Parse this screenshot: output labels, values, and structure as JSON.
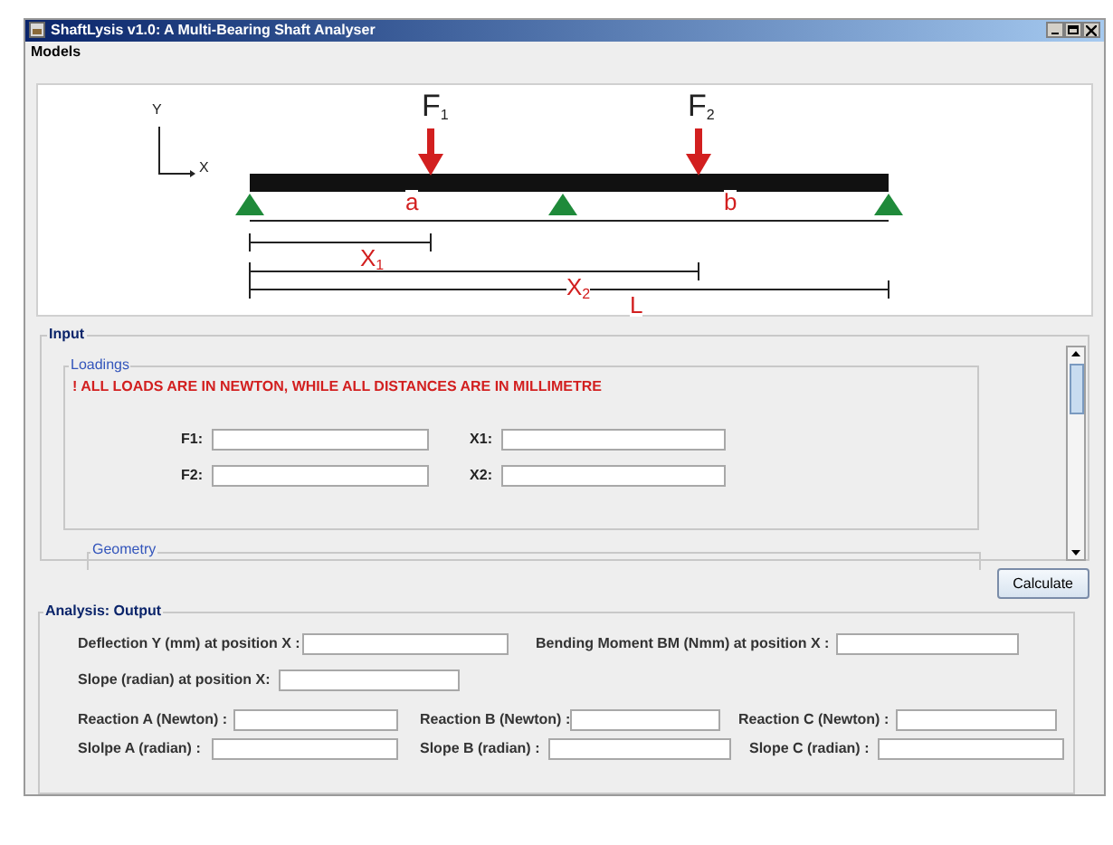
{
  "window": {
    "title": "ShaftLysis v1.0: A Multi-Bearing Shaft Analyser"
  },
  "menu": [
    "Models"
  ],
  "diagram": {
    "labels": [
      "Y",
      "X",
      "F$_{1}$",
      "F$_{2}$",
      "a",
      "b",
      "X$_{1}$",
      "X$_{2}$",
      "L"
    ]
  },
  "input": {
    "title": "Input",
    "loadings": {
      "title": "Loadings",
      "warning": "! ALL LOADS ARE IN NEWTON, WHILE ALL DISTANCES ARE IN MILLIMETRE",
      "fields": [
        {
          "label": "F1:"
        },
        {
          "label": "X1:"
        },
        {
          "label": "F2:"
        },
        {
          "label": "X2:"
        }
      ]
    },
    "geometry": {
      "title": "Geometry"
    }
  },
  "calculate_button": "Calculate",
  "output": {
    "title": "Analysis: Output",
    "rows": [
      [
        {
          "label": "Deflection Y (mm) at position X :"
        },
        {
          "label": "Bending Moment BM (Nmm) at position X :"
        }
      ],
      [
        {
          "label": "Slope (radian) at position X:"
        }
      ],
      [
        {
          "label": "Reaction A (Newton) :"
        },
        {
          "label": "Reaction B (Newton) :"
        },
        {
          "label": "Reaction C (Newton) :"
        }
      ],
      [
        {
          "label": "Slolpe A (radian) :"
        },
        {
          "label": "Slope B (radian) :"
        },
        {
          "label": "Slope C (radian) :"
        }
      ]
    ]
  }
}
